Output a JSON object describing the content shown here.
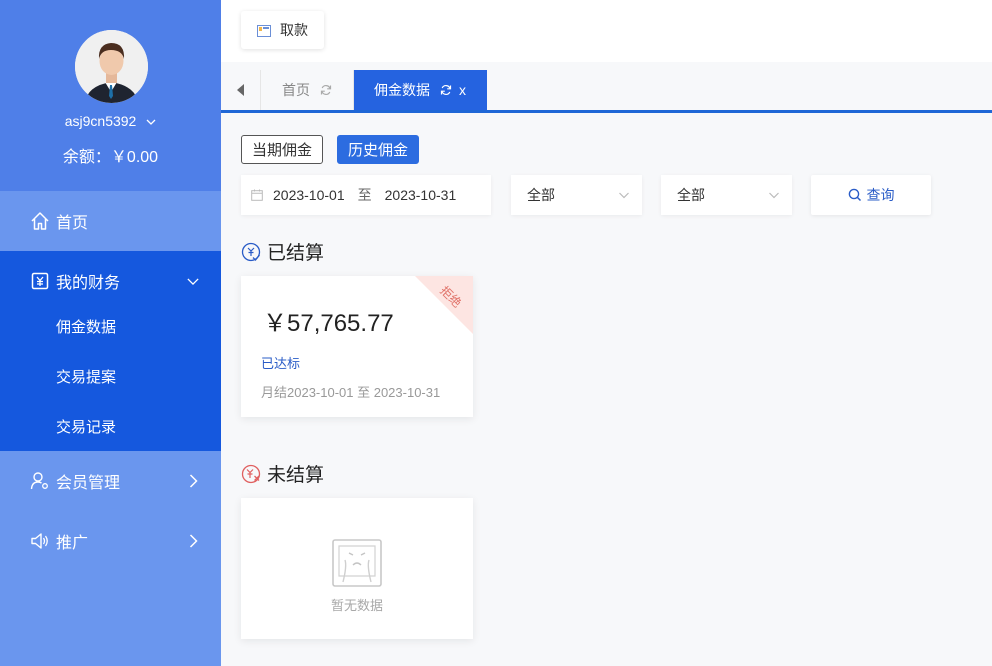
{
  "profile": {
    "username": "asj9cn5392",
    "balance": "余额：￥0.00"
  },
  "sidebar": {
    "items": [
      {
        "label": "首页",
        "icon": "home-icon"
      },
      {
        "label": "我的财务",
        "icon": "finance-icon"
      },
      {
        "label": "会员管理",
        "icon": "member-icon"
      },
      {
        "label": "推广",
        "icon": "speaker-icon"
      }
    ],
    "finance_sub": [
      {
        "label": "佣金数据"
      },
      {
        "label": "交易提案"
      },
      {
        "label": "交易记录"
      }
    ]
  },
  "toolbar": {
    "withdraw_label": "取款"
  },
  "tabs": {
    "home_label": "首页",
    "commission_label": "佣金数据",
    "close": "x"
  },
  "filters": {
    "current_label": "当期佣金",
    "history_label": "历史佣金",
    "date_start": "2023-10-01",
    "date_sep": "至",
    "date_end": "2023-10-31",
    "select1": "全部",
    "select2": "全部",
    "query_label": "查询"
  },
  "settled": {
    "title": "已结算",
    "amount": "￥57,765.77",
    "ribbon": "拒绝",
    "status": "已达标",
    "period": "月结2023-10-01 至 2023-10-31"
  },
  "unsettled": {
    "title": "未结算",
    "empty_text": "暂无数据"
  },
  "colors": {
    "sidebar_bg": "#6a96ee",
    "profile_bg": "#4f7fe8",
    "active_nav": "#1558de",
    "accent": "#2563e0"
  }
}
